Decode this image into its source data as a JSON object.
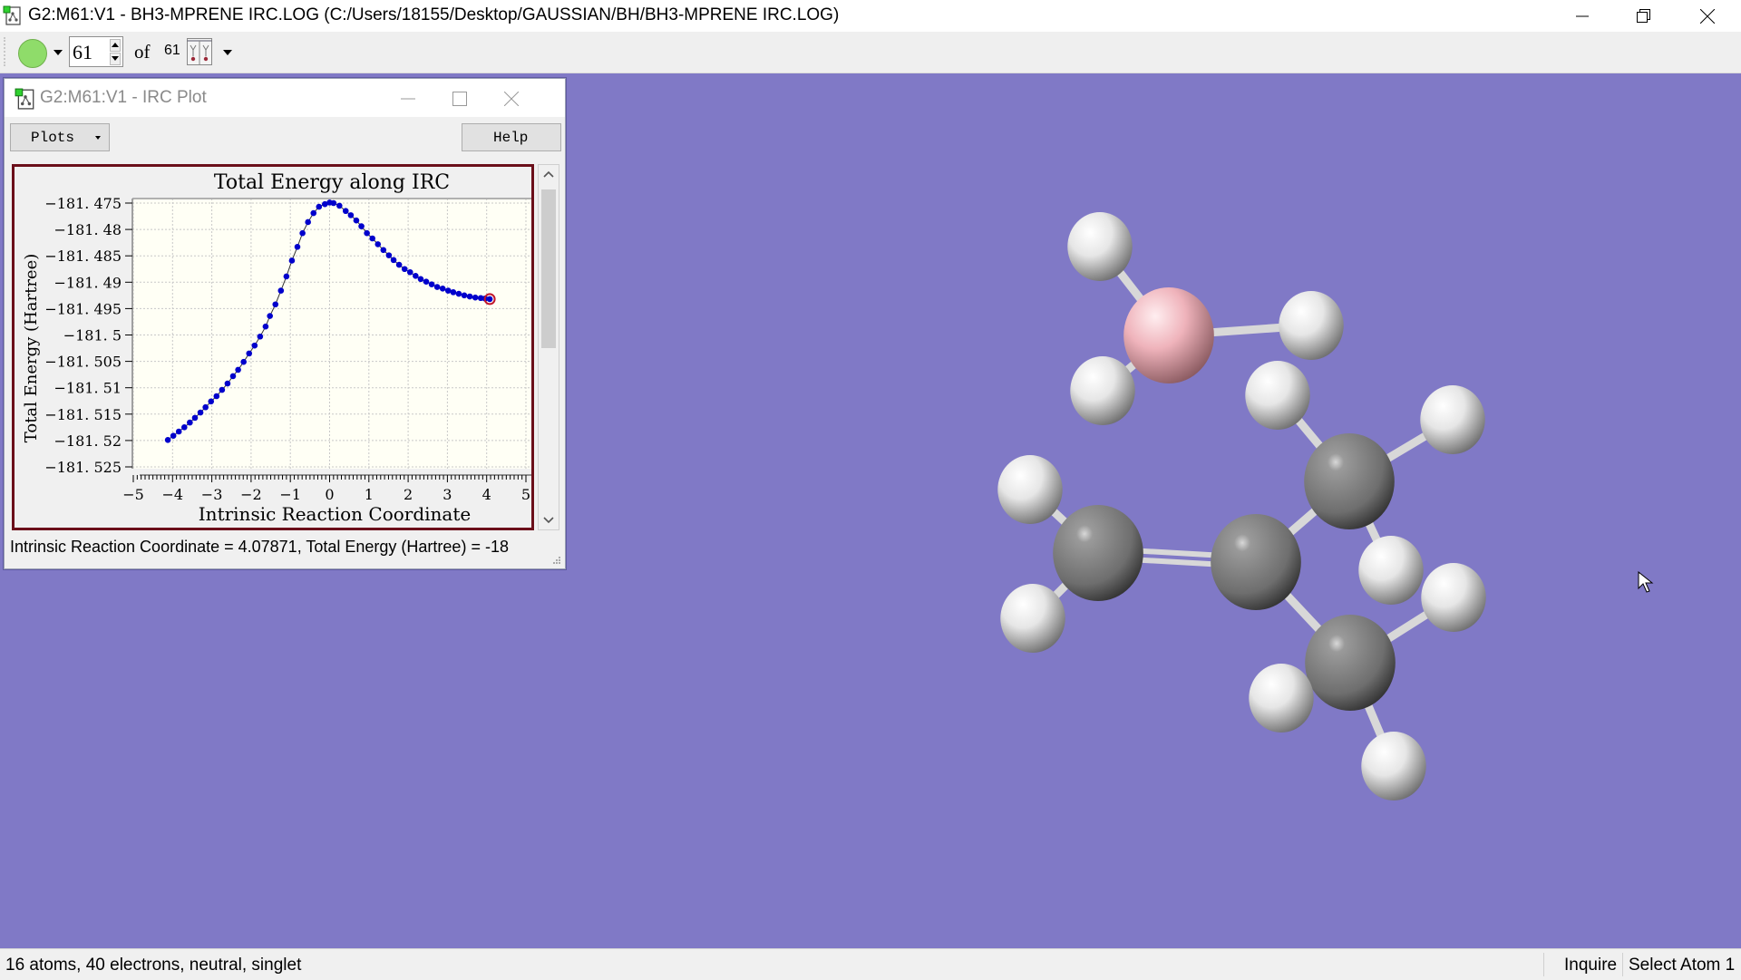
{
  "window": {
    "title": "G2:M61:V1 - BH3-MPRENE IRC.LOG (C:/Users/18155/Desktop/GAUSSIAN/BH/BH3-MPRENE IRC.LOG)",
    "icon": "gaussview-document-icon",
    "controls": [
      "minimize-icon",
      "restore-icon",
      "close-icon"
    ]
  },
  "toolbar": {
    "atom_color_icon": "green-circle",
    "current_frame": "61",
    "of_label": "of",
    "total_frames": "61",
    "irc_icon": "irc-plot-icon"
  },
  "irc_window": {
    "title": "G2:M61:V1 - IRC Plot",
    "plots_label": "Plots",
    "help_label": "Help",
    "readout": "Intrinsic Reaction Coordinate = 4.07871, Total Energy (Hartree) = -18",
    "selected_point_color": "#c0142a",
    "point_color": "#0000cc"
  },
  "chart_data": {
    "type": "line",
    "title": "Total Energy along IRC",
    "xlabel": "Intrinsic Reaction Coordinate",
    "ylabel": "Total Energy (Hartree)",
    "xlim": [
      -5,
      5
    ],
    "ylim": [
      -181.525,
      -181.475
    ],
    "xticks": [
      "-5",
      "-4",
      "-3",
      "-2",
      "-1",
      "0",
      "1",
      "2",
      "3",
      "4",
      "5"
    ],
    "yticks": [
      "-181.475",
      "-181.48",
      "-181.485",
      "-181.49",
      "-181.495",
      "-181.5",
      "-181.505",
      "-181.51",
      "-181.515",
      "-181.52",
      "-181.525"
    ],
    "grid": true,
    "selected_index": 60,
    "x": [
      -4.12,
      -3.98,
      -3.84,
      -3.7,
      -3.56,
      -3.43,
      -3.29,
      -3.16,
      -3.02,
      -2.88,
      -2.74,
      -2.6,
      -2.46,
      -2.33,
      -2.19,
      -2.05,
      -1.91,
      -1.77,
      -1.63,
      -1.52,
      -1.38,
      -1.24,
      -1.1,
      -0.96,
      -0.82,
      -0.69,
      -0.55,
      -0.41,
      -0.27,
      -0.12,
      0.0,
      0.1,
      0.25,
      0.41,
      0.54,
      0.68,
      0.81,
      0.95,
      1.09,
      1.23,
      1.37,
      1.51,
      1.63,
      1.77,
      1.91,
      2.05,
      2.19,
      2.32,
      2.46,
      2.6,
      2.74,
      2.88,
      3.02,
      3.15,
      3.29,
      3.43,
      3.57,
      3.71,
      3.85,
      3.96,
      4.07871
    ],
    "y": [
      -181.5199,
      -181.5191,
      -181.5183,
      -181.5175,
      -181.5166,
      -181.5157,
      -181.5147,
      -181.5137,
      -181.5126,
      -181.5116,
      -181.5104,
      -181.5092,
      -181.5078,
      -181.5066,
      -181.5051,
      -181.5035,
      -181.502,
      -181.5003,
      -181.4984,
      -181.4964,
      -181.4942,
      -181.4916,
      -181.4889,
      -181.4859,
      -181.4833,
      -181.4807,
      -181.4786,
      -181.4769,
      -181.4757,
      -181.4752,
      -181.4749,
      -181.475,
      -181.4755,
      -181.4765,
      -181.4773,
      -181.4783,
      -181.4794,
      -181.4807,
      -181.4817,
      -181.4828,
      -181.4839,
      -181.4849,
      -181.4858,
      -181.4867,
      -181.4875,
      -181.4881,
      -181.4888,
      -181.4894,
      -181.4899,
      -181.4904,
      -181.4909,
      -181.4912,
      -181.4916,
      -181.4919,
      -181.4922,
      -181.4925,
      -181.4927,
      -181.4929,
      -181.493,
      -181.4931,
      -181.4932
    ]
  },
  "molecule": {
    "atoms": [
      {
        "element": "H",
        "id": "H1"
      },
      {
        "element": "B",
        "id": "B1"
      },
      {
        "element": "H",
        "id": "H2"
      },
      {
        "element": "H",
        "id": "H3"
      },
      {
        "element": "H",
        "id": "H4"
      },
      {
        "element": "C",
        "id": "C1"
      },
      {
        "element": "H",
        "id": "H5"
      },
      {
        "element": "H",
        "id": "H6"
      },
      {
        "element": "C",
        "id": "C2"
      },
      {
        "element": "C",
        "id": "C3"
      },
      {
        "element": "H",
        "id": "H7"
      },
      {
        "element": "H",
        "id": "H8"
      },
      {
        "element": "H",
        "id": "H9"
      },
      {
        "element": "C",
        "id": "C4"
      },
      {
        "element": "H",
        "id": "H10"
      },
      {
        "element": "H",
        "id": "H11"
      }
    ],
    "colors": {
      "background": "#8079c6",
      "H": "#f2f2f2",
      "B": "#f2b6bd",
      "C": "#8a8a8a",
      "bond": "#d8d8d8"
    }
  },
  "statusbar": {
    "info": "16 atoms, 40 electrons, neutral, singlet",
    "mode": "Inquire",
    "action": "Select Atom 1"
  }
}
